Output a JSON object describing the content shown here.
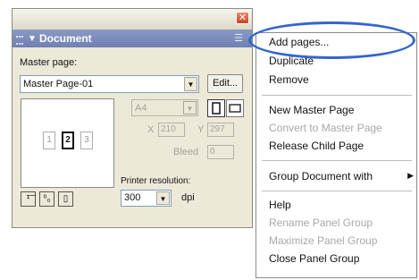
{
  "panel": {
    "title": "Document",
    "master_page_label": "Master page:",
    "master_page_value": "Master Page-01",
    "edit_button": "Edit...",
    "page_size": "A4",
    "x_label": "X",
    "y_label": "Y",
    "x_value": "210",
    "y_value": "297",
    "bleed_label": "Bleed",
    "bleed_value": "0",
    "pages": [
      "1",
      "2",
      "3"
    ],
    "printer_resolution_label": "Printer resolution:",
    "printer_resolution_value": "300",
    "dpi_label": "dpi",
    "close_glyph": "✕"
  },
  "menu": {
    "items": [
      {
        "label": "Add pages...",
        "enabled": true
      },
      {
        "label": "Duplicate",
        "enabled": true
      },
      {
        "label": "Remove",
        "enabled": true
      },
      {
        "label": "New Master Page",
        "enabled": true
      },
      {
        "label": "Convert to Master Page",
        "enabled": false
      },
      {
        "label": "Release Child Page",
        "enabled": true
      },
      {
        "label": "Group Document with",
        "enabled": true,
        "submenu": true
      },
      {
        "label": "Help",
        "enabled": true
      },
      {
        "label": "Rename Panel Group",
        "enabled": false
      },
      {
        "label": "Maximize Panel Group",
        "enabled": false
      },
      {
        "label": "Close Panel Group",
        "enabled": true
      }
    ],
    "highlight_color": "#3366cc"
  }
}
